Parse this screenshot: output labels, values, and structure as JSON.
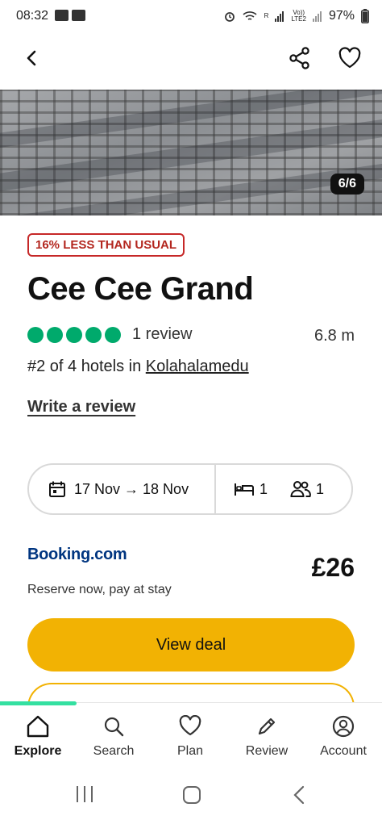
{
  "status_bar": {
    "time": "08:32",
    "battery": "97%",
    "network_label_top": "Vo))",
    "network_label_bottom": "LTE2",
    "carrier_mark": "R"
  },
  "nav": {
    "back_icon": "chevron-left-icon",
    "share_icon": "share-icon",
    "save_icon": "heart-icon"
  },
  "photo": {
    "counter": "6/6"
  },
  "hotel": {
    "badge": "16% LESS THAN USUAL",
    "name": "Cee Cee Grand",
    "rating_bubbles": 5,
    "review_count": "1 review",
    "distance": "6.8 m",
    "rank_prefix": "#2 of 4 hotels in ",
    "rank_location": "Kolahalamedu",
    "write_review": "Write a review"
  },
  "booking": {
    "dates": "17 Nov → 18 Nov",
    "rooms": "1",
    "guests": "1"
  },
  "offer": {
    "provider": "Booking.com",
    "price": "£26",
    "note": "Reserve now, pay at stay",
    "cta": "View deal"
  },
  "tabs": [
    {
      "label": "Explore",
      "icon": "home-icon",
      "active": true
    },
    {
      "label": "Search",
      "icon": "search-icon",
      "active": false
    },
    {
      "label": "Plan",
      "icon": "heart-icon",
      "active": false
    },
    {
      "label": "Review",
      "icon": "pencil-icon",
      "active": false
    },
    {
      "label": "Account",
      "icon": "account-icon",
      "active": false
    }
  ],
  "colors": {
    "accent_green": "#00aa6c",
    "cta_yellow": "#f2b203",
    "badge_red": "#c62828",
    "booking_blue": "#003580"
  }
}
